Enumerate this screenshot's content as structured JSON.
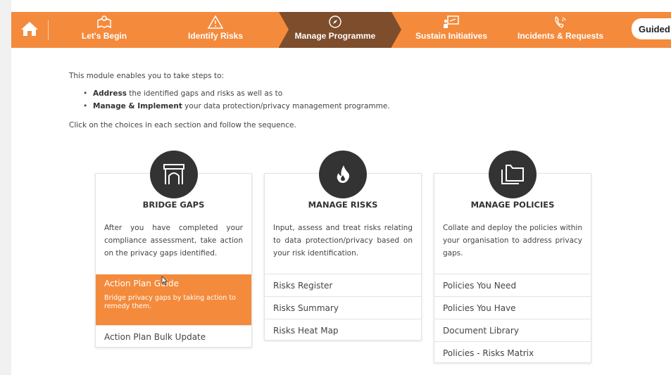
{
  "nav": {
    "items": [
      {
        "label": "Let's Begin",
        "icon": "map-location-icon"
      },
      {
        "label": "Identify Risks",
        "icon": "warning-triangle-icon"
      },
      {
        "label": "Manage Programme",
        "icon": "compass-icon"
      },
      {
        "label": "Sustain Initiatives",
        "icon": "presentation-icon"
      },
      {
        "label": "Incidents & Requests",
        "icon": "phone-ringing-icon"
      }
    ],
    "active_index": 2,
    "guided_label": "Guided",
    "colors": {
      "bar": "#f48a3b",
      "active": "#7d4d2c"
    }
  },
  "intro": {
    "line1": "This module enables you to take steps to:",
    "bullets": [
      {
        "bold": "Address",
        "rest": " the identified gaps and risks as well as to"
      },
      {
        "bold": "Manage & Implement",
        "rest": " your data protection/privacy management programme."
      }
    ],
    "line2": "Click on the choices in each section and follow the sequence."
  },
  "cards": [
    {
      "title": "BRIDGE GAPS",
      "icon": "archway-icon",
      "description": "After you have completed your compliance assessment, take action on the privacy gaps identified.",
      "links": [
        {
          "label": "Action Plan Guide",
          "sub": "Bridge privacy gaps by taking action to remedy them.",
          "highlight": true
        },
        {
          "label": "Action Plan Bulk Update"
        }
      ]
    },
    {
      "title": "MANAGE RISKS",
      "icon": "flame-icon",
      "description": "Input, assess and treat risks relating to data protection/privacy based on your risk identification.",
      "links": [
        {
          "label": "Risks Register"
        },
        {
          "label": "Risks Summary"
        },
        {
          "label": "Risks Heat Map"
        }
      ]
    },
    {
      "title": "MANAGE POLICIES",
      "icon": "folders-icon",
      "description": "Collate and deploy the policies within your organisation to address privacy gaps.",
      "links": [
        {
          "label": "Policies You Need"
        },
        {
          "label": "Policies You Have"
        },
        {
          "label": "Document Library"
        },
        {
          "label": "Policies - Risks Matrix"
        }
      ]
    }
  ],
  "accent_color": "#f48a3b"
}
